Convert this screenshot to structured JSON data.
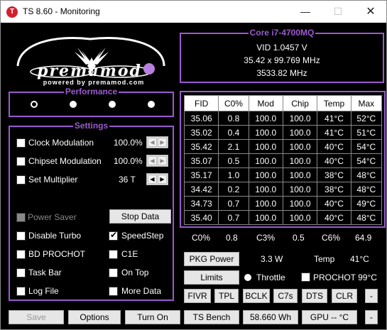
{
  "window": {
    "title": "TS 8.60 - Monitoring",
    "icon_letter": "T",
    "min": "—",
    "max": "☐",
    "close": "✕"
  },
  "logo": {
    "text": "premamod",
    "tagline": "powered by premamod.com"
  },
  "cpu": {
    "name": "Core i7-4700MQ",
    "vid": "VID  1.0457 V",
    "bclk": "35.42 x 99.769 MHz",
    "freq": "3533.82 MHz"
  },
  "performance": {
    "title": "Performance",
    "selected_index": 0,
    "count": 4
  },
  "settings": {
    "title": "Settings",
    "clock_modulation": {
      "label": "Clock Modulation",
      "value": "100.0%"
    },
    "chipset_modulation": {
      "label": "Chipset Modulation",
      "value": "100.0%"
    },
    "set_multiplier": {
      "label": "Set Multiplier",
      "value": "36 T"
    },
    "power_saver": "Power Saver",
    "stop_data": "Stop Data",
    "disable_turbo": "Disable Turbo",
    "speedstep": "SpeedStep",
    "bd_prochot": "BD PROCHOT",
    "c1e": "C1E",
    "task_bar": "Task Bar",
    "on_top": "On Top",
    "log_file": "Log File",
    "more_data": "More Data"
  },
  "table": {
    "headers": [
      "FID",
      "C0%",
      "Mod",
      "Chip",
      "Temp",
      "Max"
    ],
    "rows": [
      [
        "35.06",
        "0.8",
        "100.0",
        "100.0",
        "41°C",
        "52°C"
      ],
      [
        "35.02",
        "0.4",
        "100.0",
        "100.0",
        "41°C",
        "51°C"
      ],
      [
        "35.42",
        "2.1",
        "100.0",
        "100.0",
        "40°C",
        "54°C"
      ],
      [
        "35.07",
        "0.5",
        "100.0",
        "100.0",
        "40°C",
        "54°C"
      ],
      [
        "35.17",
        "1.0",
        "100.0",
        "100.0",
        "38°C",
        "48°C"
      ],
      [
        "34.42",
        "0.2",
        "100.0",
        "100.0",
        "38°C",
        "48°C"
      ],
      [
        "34.73",
        "0.7",
        "100.0",
        "100.0",
        "40°C",
        "49°C"
      ],
      [
        "35.40",
        "0.7",
        "100.0",
        "100.0",
        "40°C",
        "48°C"
      ]
    ]
  },
  "summary": {
    "c0_label": "C0%",
    "c0": "0.8",
    "c3_label": "C3%",
    "c3": "0.5",
    "c6_label": "C6%",
    "c6": "64.9"
  },
  "power": {
    "pkg_button": "PKG Power",
    "pkg_value": "3.3 W",
    "temp_label": "Temp",
    "temp_value": "41°C"
  },
  "limits": {
    "button": "Limits",
    "throttle": "Throttle",
    "prochot": "PROCHOT 99°C"
  },
  "tools": [
    "FIVR",
    "TPL",
    "BCLK",
    "C7s",
    "DTS",
    "CLR",
    "-"
  ],
  "bottom": {
    "save": "Save",
    "options": "Options",
    "turn_on": "Turn On",
    "ts_bench": "TS Bench",
    "wh": "58.660 Wh",
    "gpu": "GPU -- °C",
    "dash": "-"
  },
  "colors": {
    "accent": "#9b59d0",
    "close_icon_bg": "#d2202f"
  }
}
